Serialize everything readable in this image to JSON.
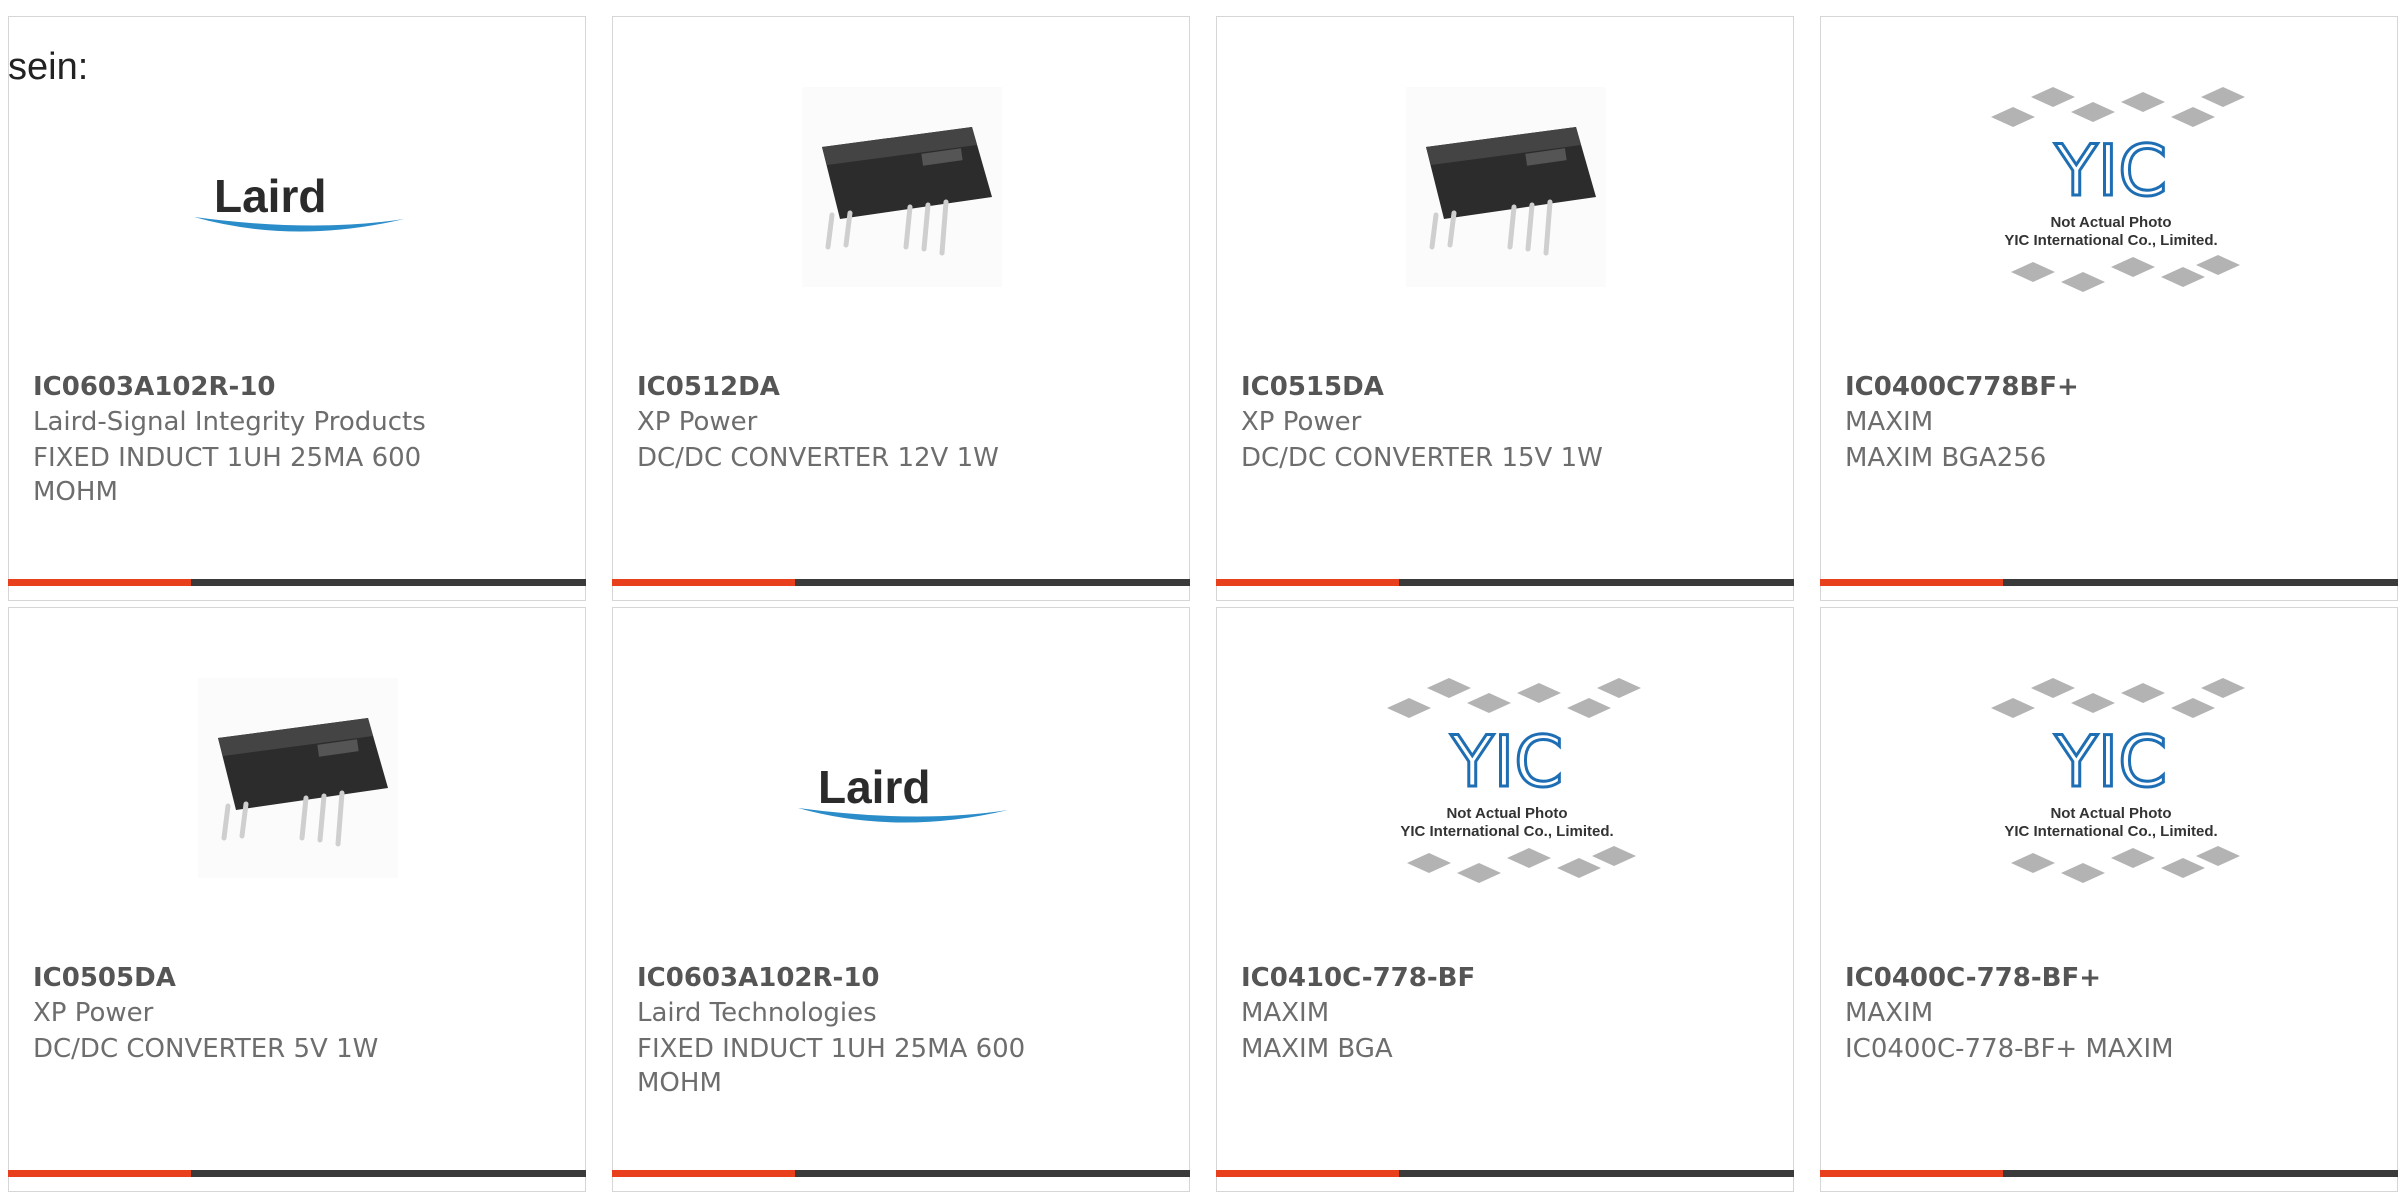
{
  "intro_text": "sein:",
  "colors": {
    "accent": "#e8401c",
    "bar": "#3a3a3a",
    "border": "#d6d6d6",
    "title": "#555555",
    "text": "#6d6d6d",
    "yic_blue": "#1e6eb4",
    "laird_blue": "#2a8cc8"
  },
  "products": [
    {
      "part": "IC0603A102R-10",
      "manufacturer": "Laird-Signal Integrity Products",
      "description": "FIXED INDUCT 1UH 25MA 600 MOHM",
      "image": "laird-logo"
    },
    {
      "part": "IC0512DA",
      "manufacturer": "XP Power",
      "description": "DC/DC CONVERTER 12V 1W",
      "image": "dip-module"
    },
    {
      "part": "IC0515DA",
      "manufacturer": "XP Power",
      "description": "DC/DC CONVERTER 15V 1W",
      "image": "dip-module"
    },
    {
      "part": "IC0400C778BF+",
      "manufacturer": "MAXIM",
      "description": "MAXIM BGA256",
      "image": "yic-placeholder"
    },
    {
      "part": "IC0505DA",
      "manufacturer": "XP Power",
      "description": "DC/DC CONVERTER 5V 1W",
      "image": "dip-module"
    },
    {
      "part": "IC0603A102R-10",
      "manufacturer": "Laird Technologies",
      "description": "FIXED INDUCT 1UH 25MA 600 MOHM",
      "image": "laird-logo"
    },
    {
      "part": "IC0410C-778-BF",
      "manufacturer": "MAXIM",
      "description": "MAXIM BGA",
      "image": "yic-placeholder"
    },
    {
      "part": "IC0400C-778-BF+",
      "manufacturer": "MAXIM",
      "description": "IC0400C-778-BF+ MAXIM",
      "image": "yic-placeholder"
    }
  ],
  "logos": {
    "laird": "Laird",
    "yic": "YIC",
    "yic_line1": "Not Actual Photo",
    "yic_line2": "YIC International Co., Limited."
  }
}
